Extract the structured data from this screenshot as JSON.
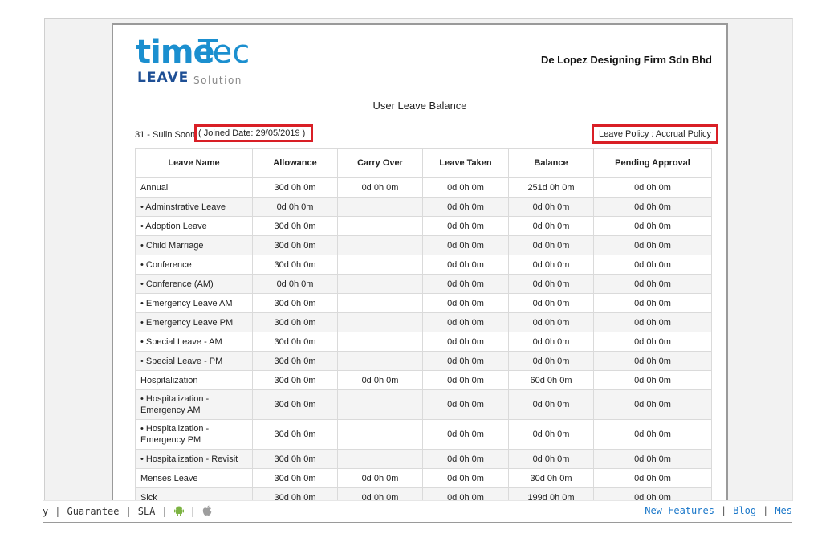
{
  "report": {
    "logo_time": "time",
    "logo_tec": "Tec",
    "logo_leave": "LEAVE",
    "logo_solution": "Solution",
    "company": "De Lopez Designing Firm Sdn Bhd",
    "title": "User Leave Balance",
    "employee": "31 - Sulin Soon",
    "joined": "( Joined Date: 29/05/2019 )",
    "policy": "Leave Policy : Accrual Policy"
  },
  "table": {
    "headers": [
      "Leave Name",
      "Allowance",
      "Carry Over",
      "Leave Taken",
      "Balance",
      "Pending Approval"
    ],
    "rows": [
      {
        "name": "Annual",
        "allowance": "30d 0h 0m",
        "carry": "0d 0h 0m",
        "taken": "0d 0h 0m",
        "balance": "251d 0h 0m",
        "pending": "0d 0h 0m"
      },
      {
        "name": "•  Adminstrative Leave",
        "allowance": "0d 0h 0m",
        "carry": "",
        "taken": "0d 0h 0m",
        "balance": "0d 0h 0m",
        "pending": "0d 0h 0m"
      },
      {
        "name": "•  Adoption Leave",
        "allowance": "30d 0h 0m",
        "carry": "",
        "taken": "0d 0h 0m",
        "balance": "0d 0h 0m",
        "pending": "0d 0h 0m"
      },
      {
        "name": "•  Child Marriage",
        "allowance": "30d 0h 0m",
        "carry": "",
        "taken": "0d 0h 0m",
        "balance": "0d 0h 0m",
        "pending": "0d 0h 0m"
      },
      {
        "name": "•  Conference",
        "allowance": "30d 0h 0m",
        "carry": "",
        "taken": "0d 0h 0m",
        "balance": "0d 0h 0m",
        "pending": "0d 0h 0m"
      },
      {
        "name": "•  Conference (AM)",
        "allowance": "0d 0h 0m",
        "carry": "",
        "taken": "0d 0h 0m",
        "balance": "0d 0h 0m",
        "pending": "0d 0h 0m"
      },
      {
        "name": "•  Emergency Leave AM",
        "allowance": "30d 0h 0m",
        "carry": "",
        "taken": "0d 0h 0m",
        "balance": "0d 0h 0m",
        "pending": "0d 0h 0m"
      },
      {
        "name": "•  Emergency Leave PM",
        "allowance": "30d 0h 0m",
        "carry": "",
        "taken": "0d 0h 0m",
        "balance": "0d 0h 0m",
        "pending": "0d 0h 0m"
      },
      {
        "name": "•  Special Leave - AM",
        "allowance": "30d 0h 0m",
        "carry": "",
        "taken": "0d 0h 0m",
        "balance": "0d 0h 0m",
        "pending": "0d 0h 0m"
      },
      {
        "name": "•  Special Leave - PM",
        "allowance": "30d 0h 0m",
        "carry": "",
        "taken": "0d 0h 0m",
        "balance": "0d 0h 0m",
        "pending": "0d 0h 0m"
      },
      {
        "name": "Hospitalization",
        "allowance": "30d 0h 0m",
        "carry": "0d 0h 0m",
        "taken": "0d 0h 0m",
        "balance": "60d 0h 0m",
        "pending": "0d 0h 0m"
      },
      {
        "name": "•  Hospitalization - Emergency AM",
        "allowance": "30d 0h 0m",
        "carry": "",
        "taken": "0d 0h 0m",
        "balance": "0d 0h 0m",
        "pending": "0d 0h 0m"
      },
      {
        "name": "•  Hospitalization - Emergency PM",
        "allowance": "30d 0h 0m",
        "carry": "",
        "taken": "0d 0h 0m",
        "balance": "0d 0h 0m",
        "pending": "0d 0h 0m"
      },
      {
        "name": "•  Hospitalization - Revisit",
        "allowance": "30d 0h 0m",
        "carry": "",
        "taken": "0d 0h 0m",
        "balance": "0d 0h 0m",
        "pending": "0d 0h 0m"
      },
      {
        "name": "Menses Leave",
        "allowance": "30d 0h 0m",
        "carry": "0d 0h 0m",
        "taken": "0d 0h 0m",
        "balance": "30d 0h 0m",
        "pending": "0d 0h 0m"
      },
      {
        "name": "Sick",
        "allowance": "30d 0h 0m",
        "carry": "0d 0h 0m",
        "taken": "0d 0h 0m",
        "balance": "199d 0h 0m",
        "pending": "0d 0h 0m"
      }
    ]
  },
  "footer": {
    "left_cut": "y",
    "guarantee": "Guarantee",
    "sla": "SLA",
    "android_icon": "android-icon",
    "apple_icon": "apple-icon",
    "new_features": "New Features",
    "blog": "Blog",
    "right_cut": "Mes",
    "link_color": "#1a77c9",
    "android_color": "#7cb342"
  },
  "colors": {
    "highlight": "#d91f26",
    "logo_blue": "#1b8fcf",
    "logo_dark": "#1e4f95"
  }
}
